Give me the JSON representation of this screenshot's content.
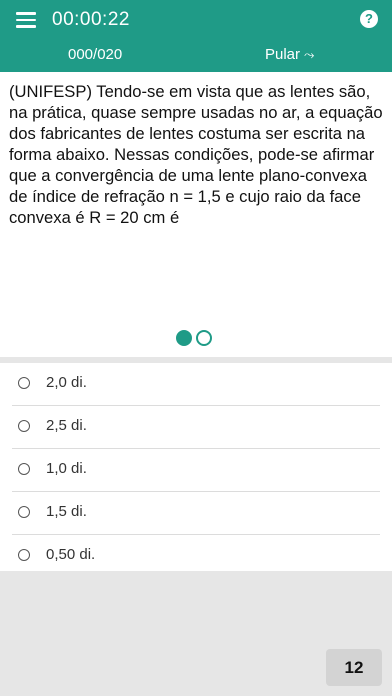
{
  "header": {
    "timer": "00:00:22",
    "counter": "000/020",
    "skip_label": "Pular",
    "skip_glyph": "⤳",
    "help_glyph": "?",
    "menu_icon": "hamburger-menu-icon",
    "accent_color": "#1f9b87"
  },
  "question": {
    "text": "(UNIFESP) Tendo-se em vista que as lentes são, na prática, quase sempre usadas no ar, a equação dos fabricantes de lentes costuma ser escrita na forma abaixo. Nessas condições, pode-se afirmar que a convergência de uma  lente plano-convexa de índice de refração n = 1,5 e cujo raio da face convexa é R = 20 cm é",
    "page_indicator": {
      "pages": 2,
      "current": 1
    }
  },
  "options": [
    {
      "label": "2,0 di."
    },
    {
      "label": "2,5 di."
    },
    {
      "label": "1,0 di."
    },
    {
      "label": "1,5 di."
    },
    {
      "label": "0,50 di."
    }
  ],
  "score": "12"
}
